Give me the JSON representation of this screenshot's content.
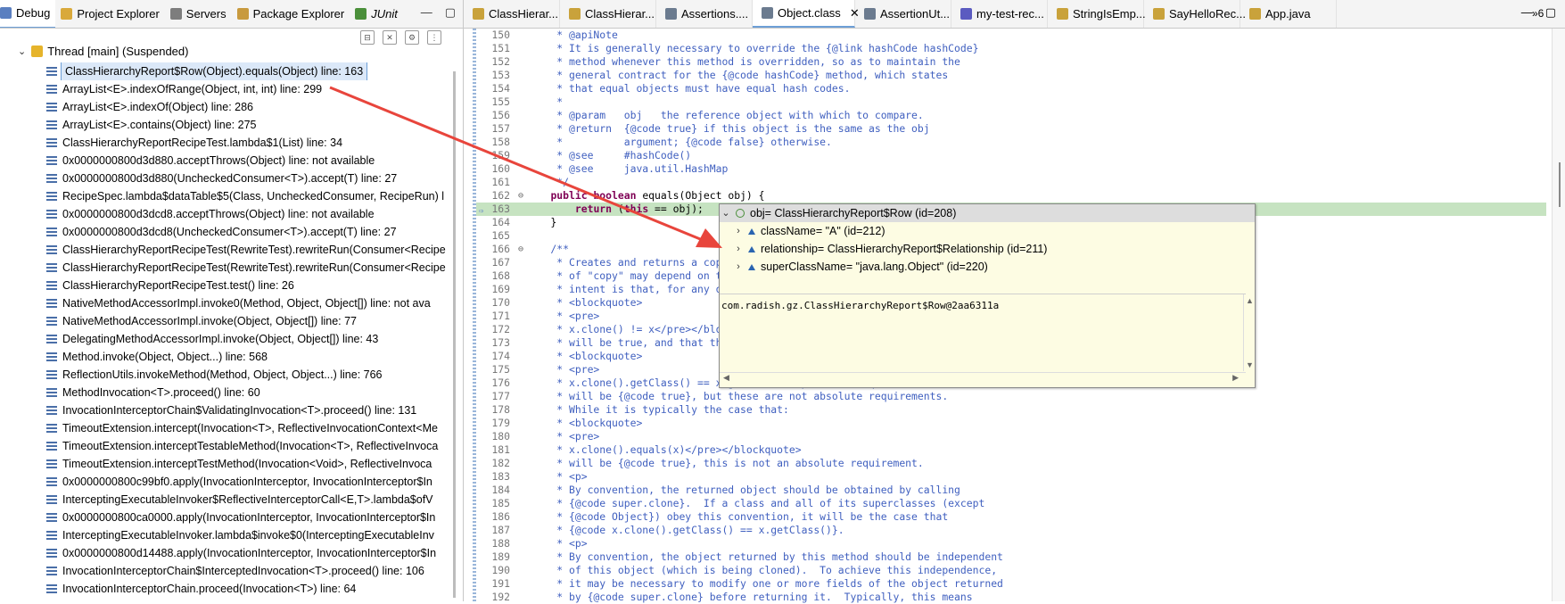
{
  "left_panel": {
    "tabs": [
      {
        "label": "Debug",
        "icon": "debug-icon",
        "active": true
      },
      {
        "label": "Project Explorer",
        "icon": "project-explorer-icon"
      },
      {
        "label": "Servers",
        "icon": "servers-icon"
      },
      {
        "label": "Package Explorer",
        "icon": "package-explorer-icon"
      },
      {
        "label": "JUnit",
        "icon": "junit-icon"
      }
    ],
    "thread_label": "Thread [main] (Suspended)",
    "frames": [
      "ClassHierarchyReport$Row(Object).equals(Object) line: 163",
      "ArrayList<E>.indexOfRange(Object, int, int) line: 299",
      "ArrayList<E>.indexOf(Object) line: 286",
      "ArrayList<E>.contains(Object) line: 275",
      "ClassHierarchyReportRecipeTest.lambda$1(List) line: 34",
      "0x0000000800d3d880.acceptThrows(Object) line: not available",
      "0x0000000800d3d880(UncheckedConsumer<T>).accept(T) line: 27",
      "RecipeSpec.lambda$dataTable$5(Class, UncheckedConsumer, RecipeRun) l",
      "0x0000000800d3dcd8.acceptThrows(Object) line: not available",
      "0x0000000800d3dcd8(UncheckedConsumer<T>).accept(T) line: 27",
      "ClassHierarchyReportRecipeTest(RewriteTest).rewriteRun(Consumer<Recipe",
      "ClassHierarchyReportRecipeTest(RewriteTest).rewriteRun(Consumer<Recipe",
      "ClassHierarchyReportRecipeTest.test() line: 26",
      "NativeMethodAccessorImpl.invoke0(Method, Object, Object[]) line: not ava",
      "NativeMethodAccessorImpl.invoke(Object, Object[]) line: 77",
      "DelegatingMethodAccessorImpl.invoke(Object, Object[]) line: 43",
      "Method.invoke(Object, Object...) line: 568",
      "ReflectionUtils.invokeMethod(Method, Object, Object...) line: 766",
      "MethodInvocation<T>.proceed() line: 60",
      "InvocationInterceptorChain$ValidatingInvocation<T>.proceed() line: 131",
      "TimeoutExtension.intercept(Invocation<T>, ReflectiveInvocationContext<Me",
      "TimeoutExtension.interceptTestableMethod(Invocation<T>, ReflectiveInvoca",
      "TimeoutExtension.interceptTestMethod(Invocation<Void>, ReflectiveInvoca",
      "0x0000000800c99bf0.apply(InvocationInterceptor, InvocationInterceptor$In",
      "InterceptingExecutableInvoker$ReflectiveInterceptorCall<E,T>.lambda$ofV",
      "0x0000000800ca0000.apply(InvocationInterceptor, InvocationInterceptor$In",
      "InterceptingExecutableInvoker.lambda$invoke$0(InterceptingExecutableInv",
      "0x0000000800d14488.apply(InvocationInterceptor, InvocationInterceptor$In",
      "InvocationInterceptorChain$InterceptedInvocation<T>.proceed() line: 106",
      "InvocationInterceptorChain.proceed(Invocation<T>) line: 64"
    ]
  },
  "editor": {
    "tabs": [
      {
        "label": "ClassHierar...",
        "icon": "java-file-icon"
      },
      {
        "label": "ClassHierar...",
        "icon": "java-file-icon"
      },
      {
        "label": "Assertions....",
        "icon": "class-file-icon"
      },
      {
        "label": "Object.class",
        "icon": "class-file-icon",
        "active": true
      },
      {
        "label": "AssertionUt...",
        "icon": "class-file-icon"
      },
      {
        "label": "my-test-rec...",
        "icon": "manifest-icon"
      },
      {
        "label": "StringIsEmp...",
        "icon": "java-file-icon"
      },
      {
        "label": "SayHelloRec...",
        "icon": "java-file-icon"
      },
      {
        "label": "App.java",
        "icon": "java-file-icon"
      }
    ],
    "overflow_label": "»6",
    "lines": [
      {
        "n": "150",
        "t": "     * @apiNote"
      },
      {
        "n": "151",
        "t": "     * It is generally necessary to override the {@link hashCode hashCode}"
      },
      {
        "n": "152",
        "t": "     * method whenever this method is overridden, so as to maintain the"
      },
      {
        "n": "153",
        "t": "     * general contract for the {@code hashCode} method, which states"
      },
      {
        "n": "154",
        "t": "     * that equal objects must have equal hash codes."
      },
      {
        "n": "155",
        "t": "     *"
      },
      {
        "n": "156",
        "t": "     * @param   obj   the reference object with which to compare."
      },
      {
        "n": "157",
        "t": "     * @return  {@code true} if this object is the same as the obj"
      },
      {
        "n": "158",
        "t": "     *          argument; {@code false} otherwise."
      },
      {
        "n": "159",
        "t": "     * @see     #hashCode()"
      },
      {
        "n": "160",
        "t": "     * @see     java.util.HashMap"
      },
      {
        "n": "161",
        "t": "     */"
      },
      {
        "n": "162",
        "t": "    public boolean equals(Object obj) {",
        "code": true,
        "fold": "⊖"
      },
      {
        "n": "163",
        "t": "        return (this == obj);",
        "code": true,
        "highlight": true
      },
      {
        "n": "164",
        "t": "    }",
        "code": true
      },
      {
        "n": "165",
        "t": ""
      },
      {
        "n": "166",
        "t": "    /**",
        "fold": "⊖"
      },
      {
        "n": "167",
        "t": "     * Creates and returns a copy of this object.  The precise meaning"
      },
      {
        "n": "168",
        "t": "     * of \"copy\" may depend on the class of the object. The general"
      },
      {
        "n": "169",
        "t": "     * intent is that, for any object {@code x}, the expression:"
      },
      {
        "n": "170",
        "t": "     * <blockquote>"
      },
      {
        "n": "171",
        "t": "     * <pre>"
      },
      {
        "n": "172",
        "t": "     * x.clone() != x</pre></blockquote>"
      },
      {
        "n": "173",
        "t": "     * will be true, and that the expression:"
      },
      {
        "n": "174",
        "t": "     * <blockquote>"
      },
      {
        "n": "175",
        "t": "     * <pre>"
      },
      {
        "n": "176",
        "t": "     * x.clone().getClass() == x.getClass()</pre></blockquote>"
      },
      {
        "n": "177",
        "t": "     * will be {@code true}, but these are not absolute requirements."
      },
      {
        "n": "178",
        "t": "     * While it is typically the case that:"
      },
      {
        "n": "179",
        "t": "     * <blockquote>"
      },
      {
        "n": "180",
        "t": "     * <pre>"
      },
      {
        "n": "181",
        "t": "     * x.clone().equals(x)</pre></blockquote>"
      },
      {
        "n": "182",
        "t": "     * will be {@code true}, this is not an absolute requirement."
      },
      {
        "n": "183",
        "t": "     * <p>"
      },
      {
        "n": "184",
        "t": "     * By convention, the returned object should be obtained by calling"
      },
      {
        "n": "185",
        "t": "     * {@code super.clone}.  If a class and all of its superclasses (except"
      },
      {
        "n": "186",
        "t": "     * {@code Object}) obey this convention, it will be the case that"
      },
      {
        "n": "187",
        "t": "     * {@code x.clone().getClass() == x.getClass()}."
      },
      {
        "n": "188",
        "t": "     * <p>"
      },
      {
        "n": "189",
        "t": "     * By convention, the object returned by this method should be independent"
      },
      {
        "n": "190",
        "t": "     * of this object (which is being cloned).  To achieve this independence,"
      },
      {
        "n": "191",
        "t": "     * it may be necessary to modify one or more fields of the object returned"
      },
      {
        "n": "192",
        "t": "     * by {@code super.clone} before returning it.  Typically, this means"
      }
    ]
  },
  "inspect_popup": {
    "root": "obj= ClassHierarchyReport$Row  (id=208)",
    "children": [
      "className= \"A\" (id=212)",
      "relationship= ClassHierarchyReport$Relationship  (id=211)",
      "superClassName= \"java.lang.Object\" (id=220)"
    ],
    "detail": "com.radish.gz.ClassHierarchyReport$Row@2aa6311a"
  },
  "colors": {
    "accent": "#6d9fd7",
    "comment": "#3f5fbf",
    "keyword": "#7f0055",
    "current_line": "#c6e3c1",
    "popup_bg": "#fdfce3",
    "annotation_arrow": "#e8453c"
  }
}
